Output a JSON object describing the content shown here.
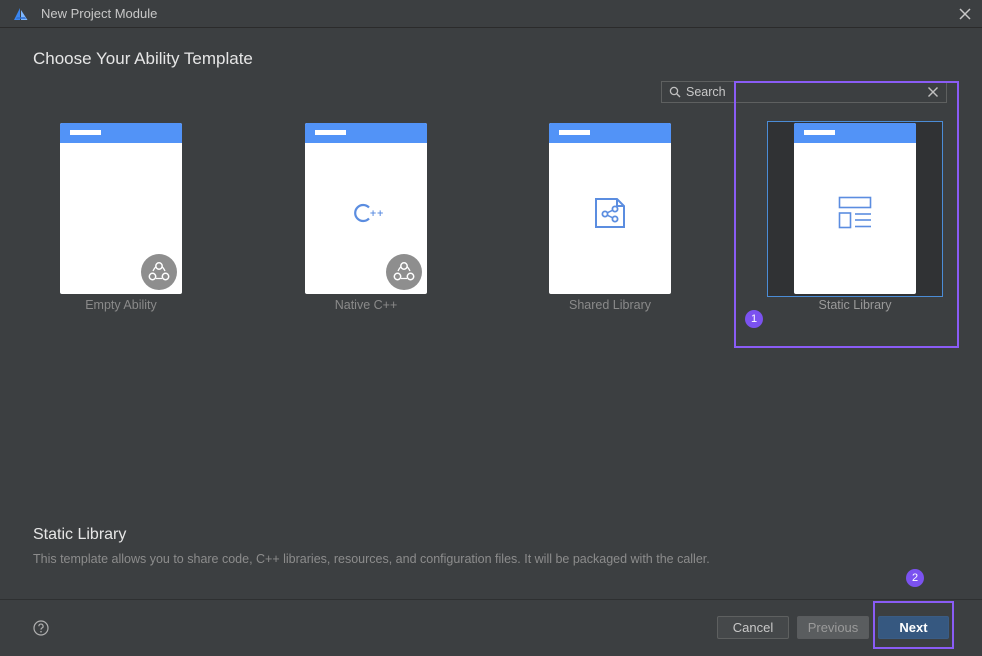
{
  "window": {
    "title": "New Project Module",
    "logo_icon": "deveco-logo-icon",
    "close_icon": "close-icon"
  },
  "heading": "Choose Your Ability Template",
  "search": {
    "placeholder": "Search",
    "value": "",
    "icon": "search-icon",
    "clear_icon": "clear-icon"
  },
  "templates": [
    {
      "label": "Empty Ability",
      "icon": "none",
      "badge_icon": "ability-badge-icon",
      "selected": false
    },
    {
      "label": "Native C++",
      "icon": "cpp-icon",
      "badge_icon": "ability-badge-icon",
      "selected": false
    },
    {
      "label": "Shared Library",
      "icon": "shared-library-icon",
      "selected": false
    },
    {
      "label": "Static Library",
      "icon": "static-library-icon",
      "selected": true
    }
  ],
  "description": {
    "title": "Static Library",
    "text": "This template allows you to share code, C++ libraries, resources, and configuration files. It will be packaged with the caller."
  },
  "footer": {
    "help_icon": "help-icon",
    "cancel_label": "Cancel",
    "previous_label": "Previous",
    "next_label": "Next"
  },
  "annotations": [
    {
      "number": "1"
    },
    {
      "number": "2"
    }
  ],
  "colors": {
    "background": "#3c3f41",
    "card_header": "#5293f7",
    "icon_blue": "#5b8de0",
    "selection_border": "#4b8cd6",
    "annotation": "#8a5cf6",
    "next_button": "#365880"
  }
}
